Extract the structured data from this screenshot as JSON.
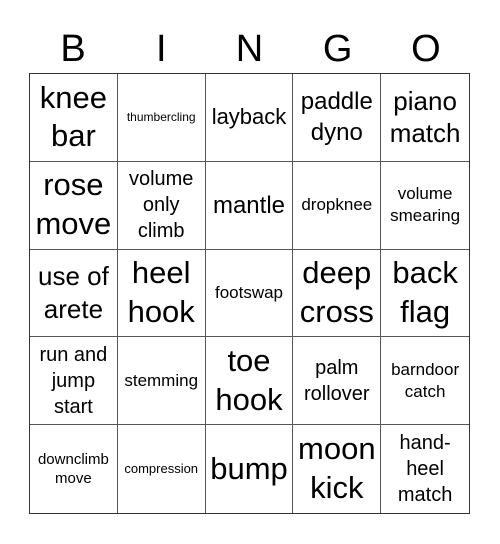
{
  "header": {
    "letters": [
      "B",
      "I",
      "N",
      "G",
      "O"
    ]
  },
  "board": {
    "cells": [
      "knee bar",
      "thumbercling",
      "layback",
      "paddle dyno",
      "piano match",
      "rose move",
      "volume only climb",
      "mantle",
      "dropknee",
      "volume smearing",
      "use of arete",
      "heel hook",
      "footswap",
      "deep cross",
      "back flag",
      "run and jump start",
      "stemming",
      "toe hook",
      "palm rollover",
      "barndoor catch",
      "downclimb move",
      "compression",
      "bump",
      "moon kick",
      "hand-heel match"
    ]
  }
}
